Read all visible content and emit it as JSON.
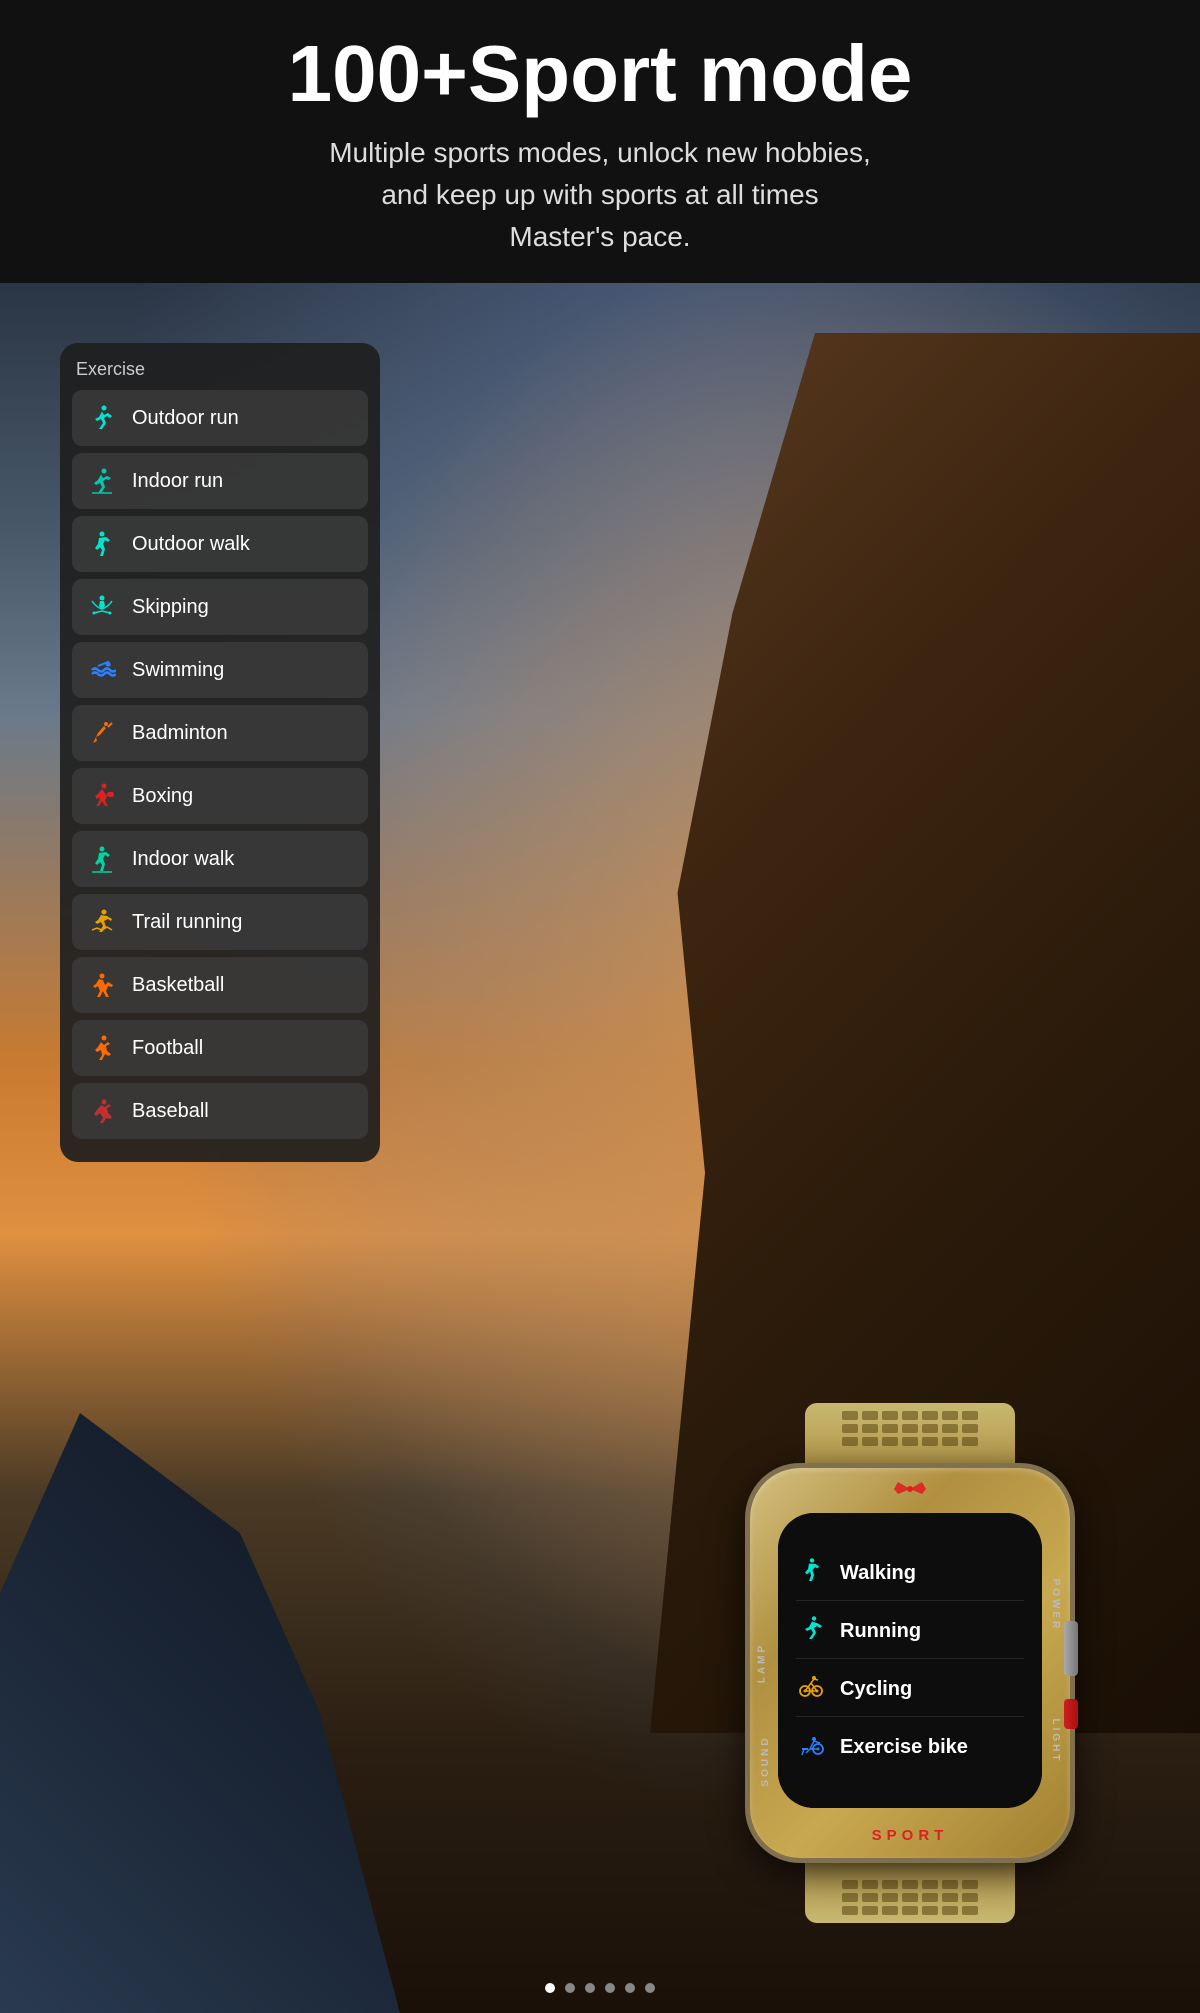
{
  "header": {
    "title": "100+Sport mode",
    "subtitle": "Multiple sports modes, unlock new hobbies,\nand keep up with sports at all times\nMaster's pace."
  },
  "exercise_panel": {
    "label": "Exercise",
    "items": [
      {
        "id": "outdoor-run",
        "name": "Outdoor run",
        "icon": "🏃",
        "icon_class": "icon-cyan"
      },
      {
        "id": "indoor-run",
        "name": "Indoor run",
        "icon": "🏃",
        "icon_class": "icon-teal"
      },
      {
        "id": "outdoor-walk",
        "name": "Outdoor walk",
        "icon": "🚶",
        "icon_class": "icon-cyan"
      },
      {
        "id": "skipping",
        "name": "Skipping",
        "icon": "⚡",
        "icon_class": "icon-cyan"
      },
      {
        "id": "swimming",
        "name": "Swimming",
        "icon": "🌊",
        "icon_class": "icon-blue"
      },
      {
        "id": "badminton",
        "name": "Badminton",
        "icon": "🏸",
        "icon_class": "icon-orange"
      },
      {
        "id": "boxing",
        "name": "Boxing",
        "icon": "🥊",
        "icon_class": "icon-red"
      },
      {
        "id": "indoor-walk",
        "name": "Indoor walk",
        "icon": "🚶",
        "icon_class": "icon-green-teal"
      },
      {
        "id": "trail-running",
        "name": "Trail running",
        "icon": "🧗",
        "icon_class": "icon-amber"
      },
      {
        "id": "basketball",
        "name": "Basketball",
        "icon": "🏀",
        "icon_class": "icon-orange"
      },
      {
        "id": "football",
        "name": "Football",
        "icon": "⚽",
        "icon_class": "icon-orange"
      },
      {
        "id": "baseball",
        "name": "Baseball",
        "icon": "⚾",
        "icon_class": "icon-red"
      }
    ]
  },
  "watch": {
    "screen_activities": [
      {
        "id": "walking",
        "label": "Walking",
        "icon": "🚶",
        "icon_class": "icon-cyan"
      },
      {
        "id": "running",
        "label": "Running",
        "icon": "🏃",
        "icon_class": "icon-cyan"
      },
      {
        "id": "cycling",
        "label": "Cycling",
        "icon": "🚴",
        "icon_class": "icon-amber"
      },
      {
        "id": "exercise-bike",
        "label": "Exercise bike",
        "icon": "🏋️",
        "icon_class": "icon-blue"
      }
    ],
    "sport_label": "SPORT",
    "label_left": "LAMP",
    "label_right": "POWER",
    "label_bottom": "SOUND",
    "label_right2": "LIGHT"
  },
  "pagination": {
    "total": 6,
    "active": 0
  }
}
